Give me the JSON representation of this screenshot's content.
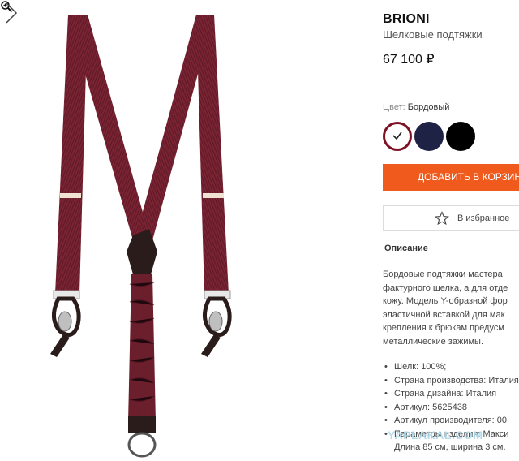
{
  "product": {
    "brand": "BRIONI",
    "name": "Шелковые подтяжки",
    "price": "67 100 ₽"
  },
  "color": {
    "label": "Цвет:",
    "value": "Бордовый",
    "swatches": [
      {
        "name": "Бордовый",
        "hex": "#7d1224",
        "selected": true
      },
      {
        "name": "navy",
        "hex": "#1e2346",
        "selected": false
      },
      {
        "name": "black",
        "hex": "#000000",
        "selected": false
      }
    ]
  },
  "actions": {
    "add_to_cart": "ДОБАВИТЬ В КОРЗИНУ",
    "favorites": "В избранное"
  },
  "description": {
    "title": "Описание",
    "lines": [
      "Бордовые подтяжки мастера",
      "фактурного шелка, а для отде",
      "кожу. Модель Y-образной фор",
      "эластичной вставкой для мак",
      "крепления к брюкам предусм",
      "металлические зажимы."
    ]
  },
  "specs": [
    {
      "text": "Шелк: 100%;"
    },
    {
      "text": "Страна производства: Италия"
    },
    {
      "text": "Страна дизайна: Италия"
    },
    {
      "text": "Артикул: 5625438"
    },
    {
      "text": "Артикул производителя: 00"
    },
    {
      "text": "Параметры изделия: Макси",
      "cont": "Длина 85 см, ширина 3 см."
    }
  ],
  "watermark": "YAPLAKAL.COM",
  "colors": {
    "accent": "#f05a1c",
    "burgundy": "#7d1224",
    "navy": "#1e2346"
  },
  "icons": [
    "zoom-icon",
    "chevron-right-icon",
    "checkmark-icon",
    "star-icon",
    "chevron-up-icon"
  ]
}
